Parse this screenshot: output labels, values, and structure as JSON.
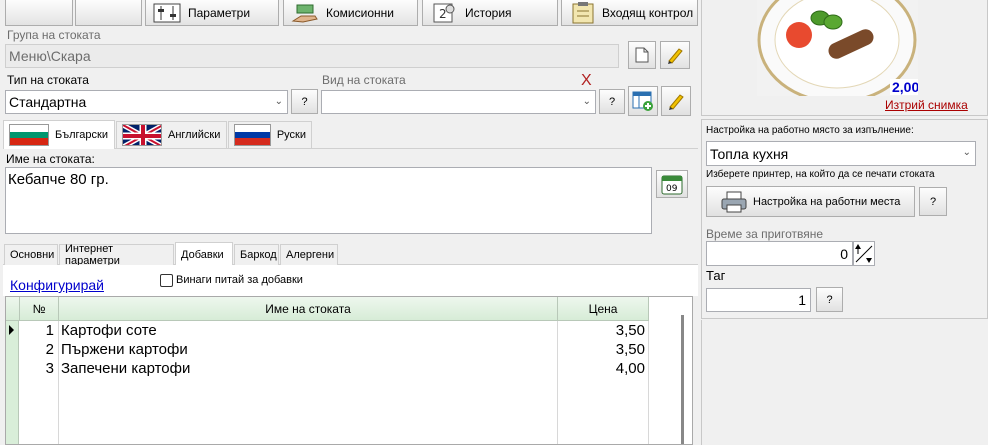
{
  "toolbar": {
    "params_label": "Параметри",
    "commission_label": "Комисионни",
    "history_label": "История",
    "incoming_label": "Входящ контрол"
  },
  "group": {
    "label": "Група на стоката",
    "value": "Меню\\Скара"
  },
  "type": {
    "label": "Тип на стоката",
    "value": "Стандартна",
    "help": "?"
  },
  "kind": {
    "label": "Вид на стоката",
    "value": "",
    "help": "?",
    "clear_mark": "X"
  },
  "languages": [
    "Български",
    "Английски",
    "Руски"
  ],
  "name": {
    "label": "Име на стоката:",
    "value": "Кебапче 80 гр."
  },
  "subtabs": [
    "Основни",
    "Интернет параметри",
    "Добавки",
    "Баркод",
    "Алергени"
  ],
  "addons": {
    "configure_link": "Конфигурирай",
    "always_ask_label": "Винаги питай за добавки",
    "always_ask_checked": false,
    "columns": {
      "num": "№",
      "name": "Име на стоката",
      "price": "Цена"
    },
    "rows": [
      {
        "num": "1",
        "name": "Картофи соте",
        "price": "3,50"
      },
      {
        "num": "2",
        "name": "Пържени картофи",
        "price": "3,50"
      },
      {
        "num": "3",
        "name": "Запечени картофи",
        "price": "4,00"
      }
    ]
  },
  "photo": {
    "price": "2,00",
    "delete_link": "Изтрий снимка"
  },
  "workplace": {
    "label": "Настройка на работно място за изпълнение:",
    "value": "Топла кухня",
    "printer_hint": "Изберете принтер, на който да се печати стоката",
    "settings_button": "Настройка на работни места",
    "help": "?"
  },
  "prep_time": {
    "label": "Време за приготвяне",
    "value": "0"
  },
  "tag": {
    "label": "Таг",
    "value": "1",
    "help": "?"
  },
  "colors": {
    "accent_link": "#0000cc",
    "delete_link": "#aa0000",
    "grid_header": "#d7ecd7",
    "x_mark": "#b22222"
  }
}
